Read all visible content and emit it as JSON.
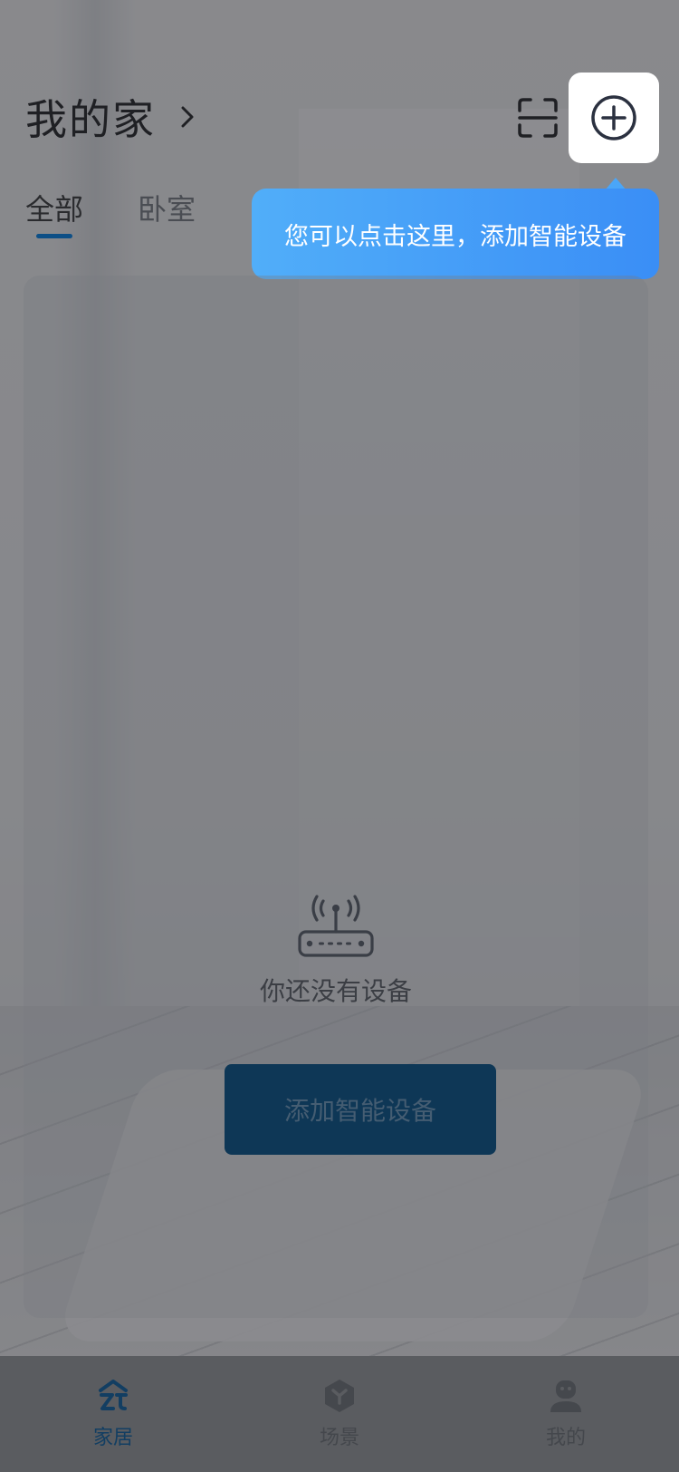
{
  "header": {
    "home_title": "我的家"
  },
  "tooltip": {
    "text": "您可以点击这里，添加智能设备"
  },
  "tabs": [
    {
      "label": "全部",
      "active": true
    },
    {
      "label": "卧室",
      "active": false
    }
  ],
  "empty_state": {
    "message": "你还没有设备",
    "button_label": "添加智能设备",
    "icon": "router-icon"
  },
  "bottom_nav": [
    {
      "label": "家居",
      "icon": "home-icon",
      "active": true
    },
    {
      "label": "场景",
      "icon": "scene-icon",
      "active": false
    },
    {
      "label": "我的",
      "icon": "profile-icon",
      "active": false
    }
  ],
  "colors": {
    "accent": "#0d4f86",
    "tooltip_start": "#51aef9",
    "tooltip_end": "#3a8ef6",
    "button_bg": "#0e3756"
  }
}
